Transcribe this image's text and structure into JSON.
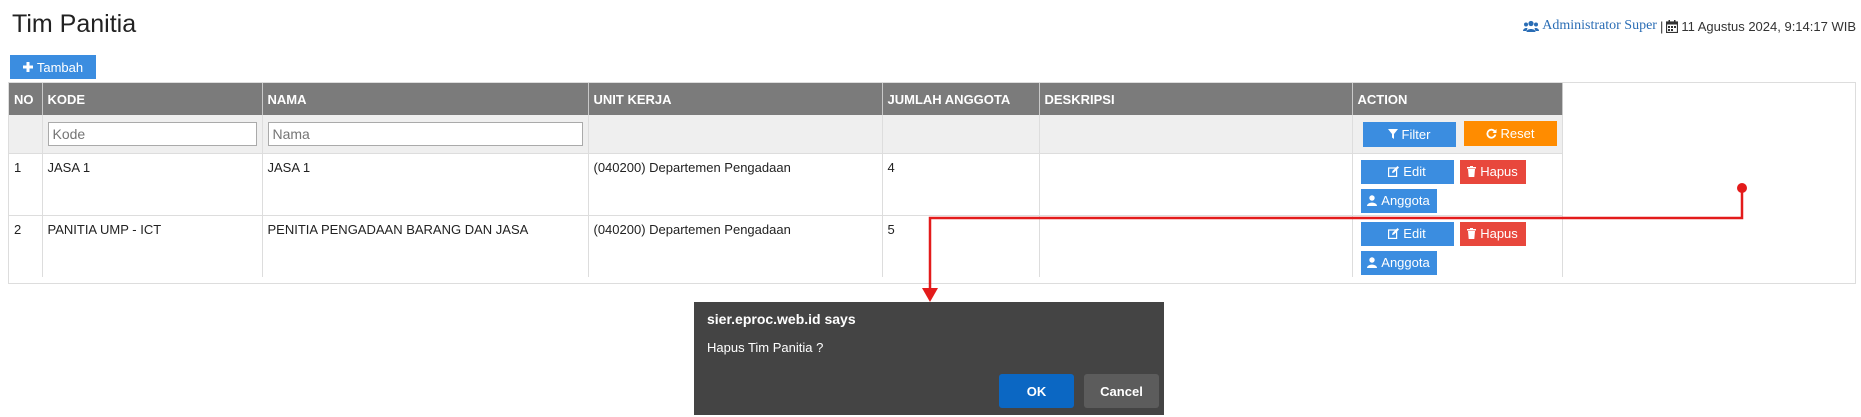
{
  "page": {
    "title": "Tim Panitia"
  },
  "header": {
    "user_name": "Administrator Super",
    "separator": "|",
    "datetime": "11 Agustus 2024, 9:14:17 WIB"
  },
  "toolbar": {
    "add_label": "Tambah"
  },
  "table": {
    "columns": [
      "NO",
      "KODE",
      "NAMA",
      "UNIT KERJA",
      "JUMLAH ANGGOTA",
      "DESKRIPSI",
      "ACTION"
    ],
    "filters": {
      "kode_placeholder": "Kode",
      "nama_placeholder": "Nama",
      "filter_label": "Filter",
      "reset_label": "Reset"
    },
    "rows": [
      {
        "no": "1",
        "kode": "JASA 1",
        "nama": "JASA 1",
        "unit_kerja": "(040200) Departemen Pengadaan",
        "jumlah_anggota": "4",
        "deskripsi": ""
      },
      {
        "no": "2",
        "kode": "PANITIA UMP - ICT",
        "nama": "PENITIA PENGADAAN BARANG DAN JASA",
        "unit_kerja": "(040200) Departemen Pengadaan",
        "jumlah_anggota": "5",
        "deskripsi": ""
      }
    ],
    "actions": {
      "edit_label": "Edit",
      "delete_label": "Hapus",
      "members_label": "Anggota"
    }
  },
  "dialog": {
    "title": "sier.eproc.web.id says",
    "message": "Hapus Tim Panitia ?",
    "ok_label": "OK",
    "cancel_label": "Cancel"
  },
  "colors": {
    "primary": "#3b8de0",
    "danger": "#e8473c",
    "warning": "#ff8c00",
    "header_bg": "#7b7b7b",
    "dialog_bg": "#444444",
    "annotation": "#e31b1b"
  }
}
